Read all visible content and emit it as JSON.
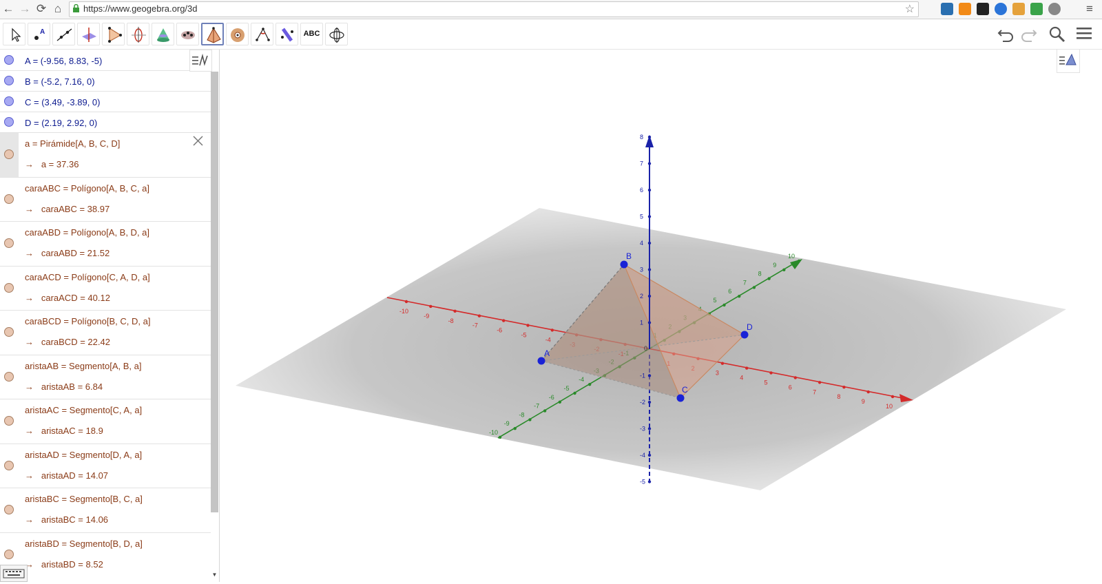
{
  "browser": {
    "url": "https://www.geogebra.org/3d",
    "nav": {
      "back": "←",
      "forward": "→",
      "reload": "⟳",
      "home": "⌂",
      "menu": "≡"
    }
  },
  "toolbar": {
    "tools": [
      "move-tool",
      "point-tool",
      "line-tool",
      "perpendicular-tool",
      "polygon-tool",
      "circle-axis-tool",
      "intersect-surfaces-tool",
      "sphere-tool",
      "pyramid-tool",
      "sphere-center-tool",
      "angle-tool",
      "reflect-tool",
      "text-tool",
      "rotate-view-tool"
    ],
    "text_tool_label": "ABC",
    "selected_tool": "pyramid-tool",
    "right_buttons": [
      "undo-icon",
      "redo-icon",
      "search-icon",
      "menu-icon"
    ]
  },
  "algebra": {
    "points": [
      {
        "def": "A = (-9.56, 8.83, -5)"
      },
      {
        "def": "B = (-5.2, 7.16, 0)"
      },
      {
        "def": "C = (3.49, -3.89, 0)"
      },
      {
        "def": "D = (2.19, 2.92, 0)"
      }
    ],
    "objects": [
      {
        "def": "a = Pirámide[A, B, C, D]",
        "arrow": "→",
        "value": "a = 37.36"
      },
      {
        "def": "caraABC = Polígono[A, B, C, a]",
        "arrow": "→",
        "value": "caraABC = 38.97"
      },
      {
        "def": "caraABD = Polígono[A, B, D, a]",
        "arrow": "→",
        "value": "caraABD = 21.52"
      },
      {
        "def": "caraACD = Polígono[C, A, D, a]",
        "arrow": "→",
        "value": "caraACD = 40.12"
      },
      {
        "def": "caraBCD = Polígono[B, C, D, a]",
        "arrow": "→",
        "value": "caraBCD = 22.42"
      },
      {
        "def": "aristaAB = Segmento[A, B, a]",
        "arrow": "→",
        "value": "aristaAB = 6.84"
      },
      {
        "def": "aristaAC = Segmento[C, A, a]",
        "arrow": "→",
        "value": "aristaAC = 18.9"
      },
      {
        "def": "aristaAD = Segmento[D, A, a]",
        "arrow": "→",
        "value": "aristaAD = 14.07"
      },
      {
        "def": "aristaBC = Segmento[B, C, a]",
        "arrow": "→",
        "value": "aristaBC = 14.06"
      },
      {
        "def": "aristaBD = Segmento[B, D, a]",
        "arrow": "→",
        "value": "aristaBD = 8.52"
      }
    ]
  },
  "view3d": {
    "point_labels": {
      "A": "A",
      "B": "B",
      "C": "C",
      "D": "D"
    },
    "x_ticks": [
      "-10",
      "-9",
      "-8",
      "-7",
      "-6",
      "-5",
      "-4",
      "-3",
      "-2",
      "-1",
      "1",
      "2",
      "3",
      "4",
      "5",
      "6",
      "7",
      "8",
      "9",
      "10"
    ],
    "y_ticks": [
      "-10",
      "-9",
      "-8",
      "-7",
      "-6",
      "-5",
      "-4",
      "-3",
      "-2",
      "-1",
      "1",
      "2",
      "3",
      "4",
      "5",
      "6",
      "7",
      "8",
      "9",
      "10"
    ],
    "z_ticks": [
      "-5",
      "-4",
      "-3",
      "-2",
      "-1",
      "1",
      "2",
      "3",
      "4",
      "5",
      "6",
      "7",
      "8"
    ],
    "origin_label": "0",
    "colors": {
      "x_axis": "#d42a2a",
      "y_axis": "#2a8a2a",
      "z_axis": "#1a22a8",
      "points": "#1a22d6",
      "pyramid": "#c99a7c"
    }
  }
}
